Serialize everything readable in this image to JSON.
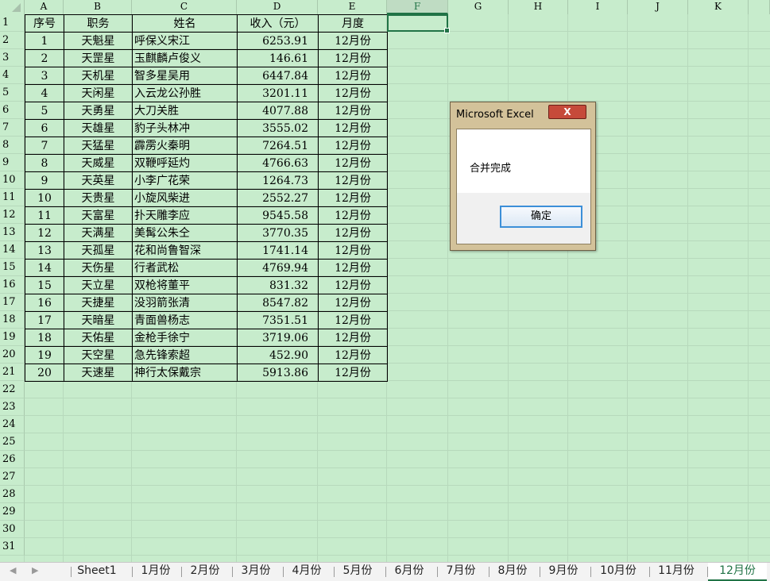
{
  "columns": [
    "A",
    "B",
    "C",
    "D",
    "E",
    "F",
    "G",
    "H",
    "I",
    "J",
    "K"
  ],
  "selected_column": "F",
  "row_numbers": [
    "1",
    "2",
    "3",
    "4",
    "5",
    "6",
    "7",
    "8",
    "9",
    "10",
    "11",
    "12",
    "13",
    "14",
    "15",
    "16",
    "17",
    "18",
    "19",
    "20",
    "21",
    "22",
    "23",
    "24",
    "25",
    "26",
    "27",
    "28",
    "29",
    "30",
    "31"
  ],
  "table": {
    "headers": [
      "序号",
      "职务",
      "姓名",
      "收入（元）",
      "月度"
    ],
    "rows": [
      [
        "1",
        "天魁星",
        "呼保义宋江",
        "6253.91",
        "12月份"
      ],
      [
        "2",
        "天罡星",
        "玉麒麟卢俊义",
        "146.61",
        "12月份"
      ],
      [
        "3",
        "天机星",
        "智多星吴用",
        "6447.84",
        "12月份"
      ],
      [
        "4",
        "天闲星",
        "入云龙公孙胜",
        "3201.11",
        "12月份"
      ],
      [
        "5",
        "天勇星",
        "大刀关胜",
        "4077.88",
        "12月份"
      ],
      [
        "6",
        "天雄星",
        "豹子头林冲",
        "3555.02",
        "12月份"
      ],
      [
        "7",
        "天猛星",
        "霹雳火秦明",
        "7264.51",
        "12月份"
      ],
      [
        "8",
        "天威星",
        "双鞭呼延灼",
        "4766.63",
        "12月份"
      ],
      [
        "9",
        "天英星",
        "小李广花荣",
        "1264.73",
        "12月份"
      ],
      [
        "10",
        "天贵星",
        "小旋风柴进",
        "2552.27",
        "12月份"
      ],
      [
        "11",
        "天富星",
        "扑天雕李应",
        "9545.58",
        "12月份"
      ],
      [
        "12",
        "天满星",
        "美髯公朱仝",
        "3770.35",
        "12月份"
      ],
      [
        "13",
        "天孤星",
        "花和尚鲁智深",
        "1741.14",
        "12月份"
      ],
      [
        "14",
        "天伤星",
        "行者武松",
        "4769.94",
        "12月份"
      ],
      [
        "15",
        "天立星",
        "双枪将董平",
        "831.32",
        "12月份"
      ],
      [
        "16",
        "天捷星",
        "没羽箭张清",
        "8547.82",
        "12月份"
      ],
      [
        "17",
        "天暗星",
        "青面兽杨志",
        "7351.51",
        "12月份"
      ],
      [
        "18",
        "天佑星",
        "金枪手徐宁",
        "3719.06",
        "12月份"
      ],
      [
        "19",
        "天空星",
        "急先锋索超",
        "452.90",
        "12月份"
      ],
      [
        "20",
        "天速星",
        "神行太保戴宗",
        "5913.86",
        "12月份"
      ]
    ]
  },
  "dialog": {
    "title": "Microsoft Excel",
    "close_label": "X",
    "message": "合并完成",
    "ok_label": "确定"
  },
  "tabs": [
    {
      "label": "Sheet1",
      "active": false
    },
    {
      "label": "1月份",
      "active": false
    },
    {
      "label": "2月份",
      "active": false
    },
    {
      "label": "3月份",
      "active": false
    },
    {
      "label": "4月份",
      "active": false
    },
    {
      "label": "5月份",
      "active": false
    },
    {
      "label": "6月份",
      "active": false
    },
    {
      "label": "7月份",
      "active": false
    },
    {
      "label": "8月份",
      "active": false
    },
    {
      "label": "9月份",
      "active": false
    },
    {
      "label": "10月份",
      "active": false
    },
    {
      "label": "11月份",
      "active": false
    },
    {
      "label": "12月份",
      "active": true
    }
  ],
  "nav_icons": [
    "scroll-left-icon",
    "scroll-right-icon"
  ],
  "colors": {
    "sheet_bg": "#c7eccc",
    "accent": "#217346",
    "dialog_frame": "#d3c29a",
    "close_red": "#c64a3a"
  }
}
